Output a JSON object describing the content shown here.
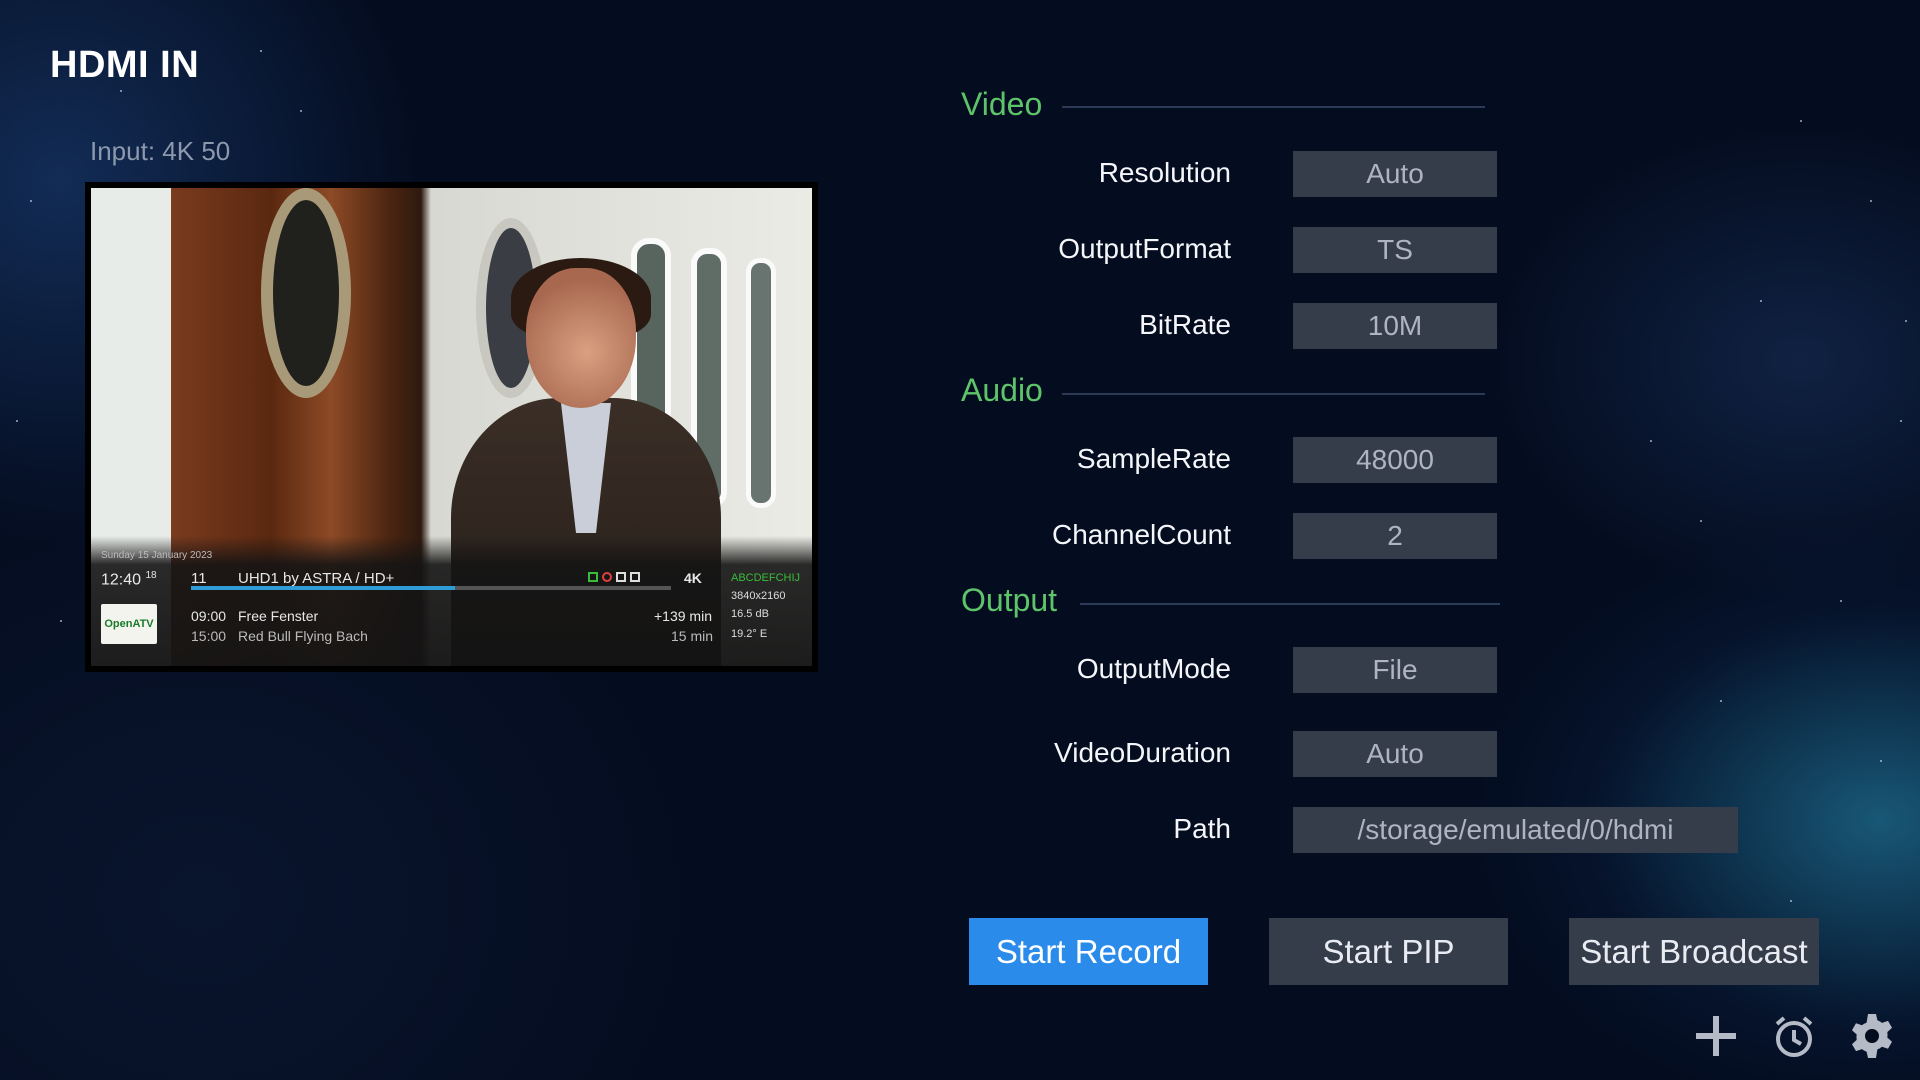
{
  "app": {
    "title": "HDMI IN",
    "input_label": "Input:",
    "input_value": "4K 50"
  },
  "preview": {
    "osd": {
      "date": "Sunday 15 January 2023",
      "time": "12:40",
      "time_sup": "18",
      "channel_number": "11",
      "channel_name": "UHD1 by ASTRA / HD+",
      "progress": 0.55,
      "logo_text": "OpenATV",
      "now_time": "09:00",
      "now_title": "Free Fenster",
      "next_time": "15:00",
      "next_title": "Red Bull Flying Bach",
      "now_remaining": "+139 min",
      "next_duration": "15 min",
      "format_badge": "4K",
      "ca_letters": "ABCDEFCHIJ",
      "resolution": "3840x2160",
      "signal": "16.5 dB",
      "position": "19.2° E"
    }
  },
  "sections": {
    "video": {
      "title": "Video",
      "rows": [
        {
          "label": "Resolution",
          "value": "Auto"
        },
        {
          "label": "OutputFormat",
          "value": "TS"
        },
        {
          "label": "BitRate",
          "value": "10M"
        }
      ]
    },
    "audio": {
      "title": "Audio",
      "rows": [
        {
          "label": "SampleRate",
          "value": "48000"
        },
        {
          "label": "ChannelCount",
          "value": "2"
        }
      ]
    },
    "output": {
      "title": "Output",
      "rows": [
        {
          "label": "OutputMode",
          "value": "File"
        },
        {
          "label": "VideoDuration",
          "value": "Auto"
        },
        {
          "label": "Path",
          "value": "/storage/emulated/0/hdmi"
        }
      ]
    }
  },
  "actions": {
    "start_record": "Start Record",
    "start_pip": "Start PIP",
    "start_broadcast": "Start Broadcast"
  },
  "toolbar": {
    "icons": [
      "plus-icon",
      "alarm-clock-icon",
      "gear-icon"
    ]
  },
  "colors": {
    "accent_green": "#5ec46a",
    "primary_button": "#2a8bea",
    "field_bg": "#363d4a",
    "background": "#040c1f"
  }
}
